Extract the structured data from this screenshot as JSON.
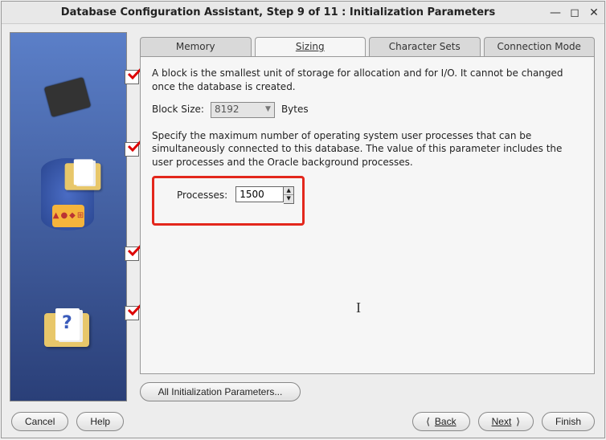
{
  "window": {
    "title": "Database Configuration Assistant, Step 9 of 11 : Initialization Parameters"
  },
  "tabs": [
    {
      "label": "Memory"
    },
    {
      "label": "Sizing"
    },
    {
      "label": "Character Sets"
    },
    {
      "label": "Connection Mode"
    }
  ],
  "active_tab_index": 1,
  "sizing": {
    "block_text": "A block is the smallest unit of storage for allocation and for I/O. It cannot be changed once the database is created.",
    "block_size_label": "Block Size:",
    "block_size_value": "8192",
    "block_size_unit": "Bytes",
    "processes_text": "Specify the maximum number of operating system user processes that can be simultaneously connected to this database. The value of this parameter includes the user processes and the Oracle background processes.",
    "processes_label": "Processes:",
    "processes_value": "1500"
  },
  "buttons": {
    "all_params": "All Initialization Parameters...",
    "cancel": "Cancel",
    "help": "Help",
    "back": "Back",
    "next": "Next",
    "finish": "Finish"
  },
  "sidebar_checks": [
    true,
    true,
    true,
    true
  ]
}
